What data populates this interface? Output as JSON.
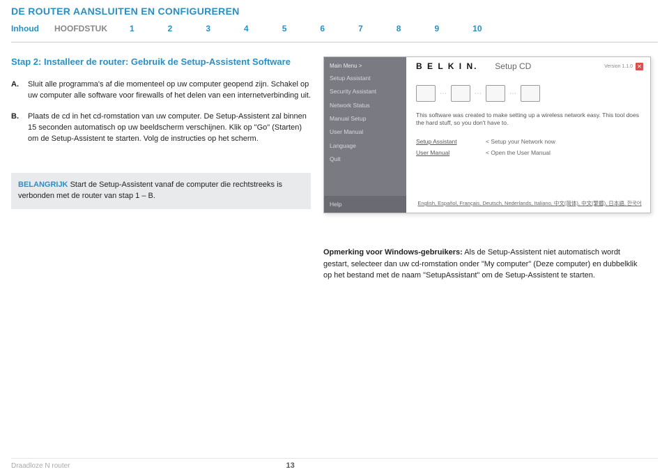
{
  "header": {
    "title": "DE ROUTER AANSLUITEN EN CONFIGUREREN"
  },
  "nav": {
    "label": "Inhoud",
    "chapter": "HOOFDSTUK",
    "numbers": [
      "1",
      "2",
      "3",
      "4",
      "5",
      "6",
      "7",
      "8",
      "9",
      "10"
    ]
  },
  "step": {
    "title": "Stap 2: Installeer de router: Gebruik de Setup-Assistent Software",
    "a_letter": "A.",
    "a_text": "Sluit alle programma's af die momenteel op uw computer geopend zijn. Schakel op uw computer alle software voor firewalls of het delen van een internetverbinding uit.",
    "b_letter": "B.",
    "b_text": "Plaats de cd in het cd-romstation van uw computer. De Setup-Assistent zal binnen 15 seconden automatisch op uw beeldscherm verschijnen. Klik op \"Go\" (Starten) om de Setup-Assistent te starten. Volg de instructies op het scherm."
  },
  "important": {
    "key": "BELANGRIJK",
    "text": " Start de Setup-Assistent vanaf de computer die rechtstreeks is verbonden met de router van stap 1 – B."
  },
  "screenshot": {
    "logo": "B E L K I N.",
    "title": "Setup CD",
    "version": "Version 1.1.0",
    "menu_header": "Main Menu  >",
    "menu_items": [
      "Setup Assistant",
      "Security Assistant",
      "Network Status",
      "Manual Setup",
      "User Manual",
      "Language",
      "Quit"
    ],
    "help": "Help",
    "desc": "This software was created to make setting up a wireless network easy. This tool does the hard stuff, so you don't have to.",
    "rows": [
      {
        "a": "Setup Assistant",
        "b": "< Setup your Network now"
      },
      {
        "a": "User Manual",
        "b": "< Open the User Manual"
      }
    ],
    "langs": "English, Español, Français, Deutsch, Nederlands, Italiano, 中文(简体), 中文(繁體), 日本語, 한국어"
  },
  "note": {
    "lead": "Opmerking voor Windows-gebruikers:",
    "text": " Als de Setup-Assistent niet automatisch wordt gestart, selecteer dan uw cd-romstation onder \"My computer\" (Deze computer) en dubbelklik op het bestand met de naam \"SetupAssistant\" om de\nSetup-Assistent te starten."
  },
  "footer": {
    "product": "Draadloze N router",
    "page": "13"
  }
}
